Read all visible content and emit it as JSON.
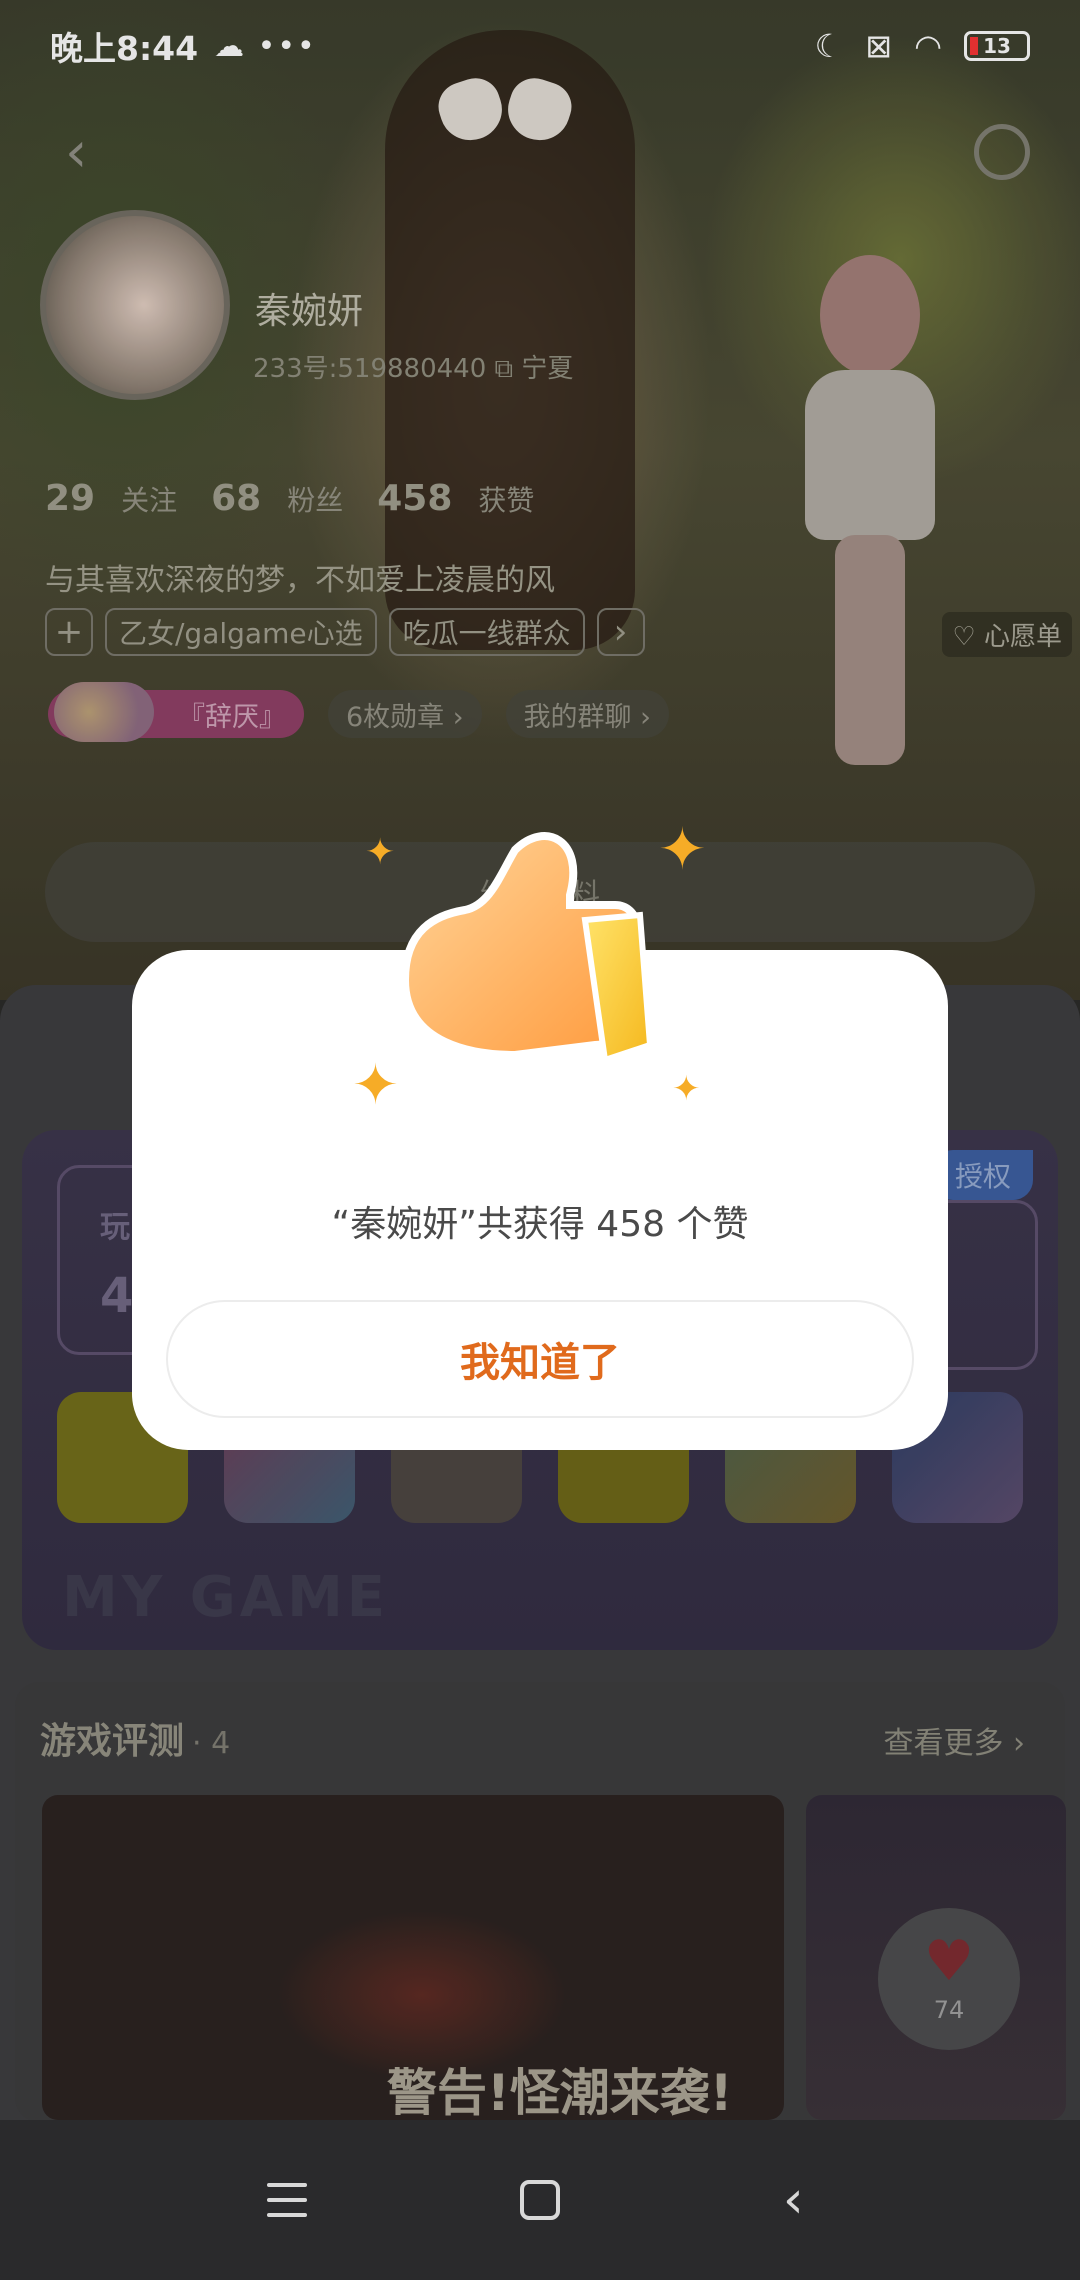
{
  "status_bar": {
    "time": "晚上8:44",
    "extra": "☁ •••",
    "battery": "13"
  },
  "profile": {
    "name": "秦婉妍",
    "id_line": "233号:519880440 ⧉ 宁夏",
    "stats": [
      {
        "num": "29",
        "label": "关注"
      },
      {
        "num": "68",
        "label": "粉丝"
      },
      {
        "num": "458",
        "label": "获赞"
      }
    ],
    "bio": "与其喜欢深夜的梦，不如爱上凌晨的风",
    "tags": [
      "乙女/galgame心选",
      "吃瓜一线群众"
    ],
    "wishlist": "♡ 心愿单",
    "badge_name": "『辞厌』",
    "medals": "6枚勋章 ›",
    "group_chat": "我的群聊 ›",
    "edit_label": "编辑资料"
  },
  "game_card": {
    "play_short": "玩",
    "play_num": "4",
    "auth_badge": "授权",
    "watermark": "MY GAME"
  },
  "reviews": {
    "title": "游戏评测",
    "count": "· 4",
    "see_more": "查看更多 ›",
    "caption": "警告!怪潮来袭!"
  },
  "like_float": {
    "count": "74"
  },
  "dialog": {
    "message": "“秦婉妍”共获得 458 个赞",
    "confirm_label": "我知道了"
  }
}
